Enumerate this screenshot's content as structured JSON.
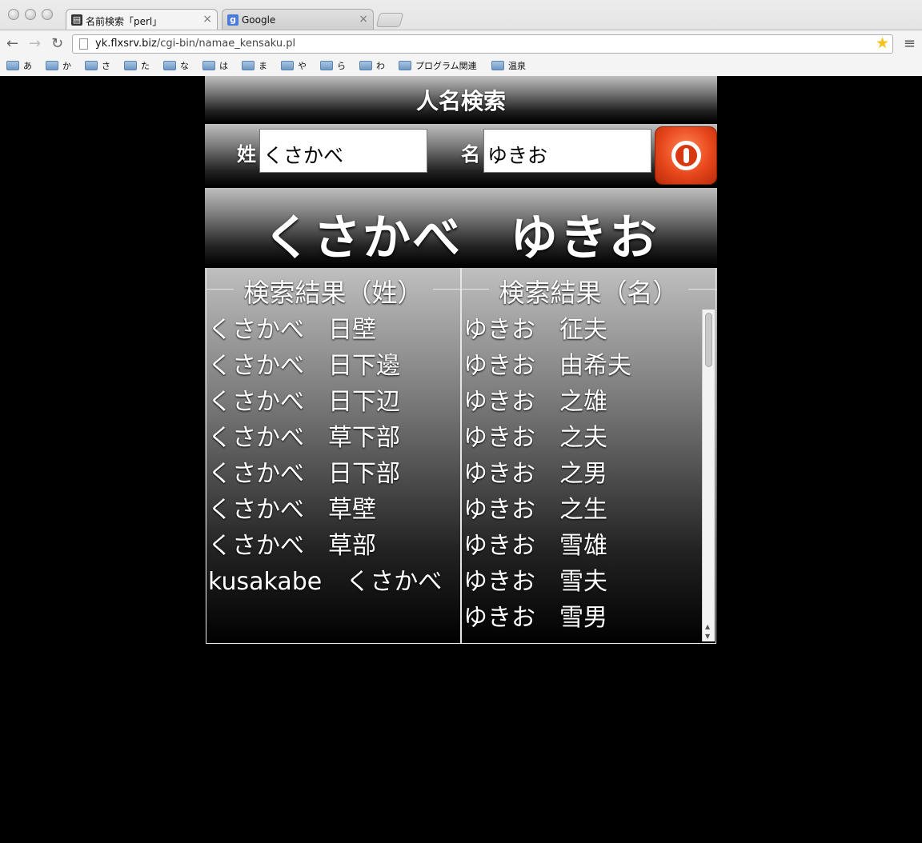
{
  "browser": {
    "tabs": [
      {
        "title": "名前検索「perl」",
        "favicon": "page-icon"
      },
      {
        "title": "Google",
        "favicon": "google-icon"
      }
    ],
    "url_host": "yk.flxsrv.biz",
    "url_path": "/cgi-bin/namae_kensaku.pl",
    "bookmarks": [
      "あ",
      "か",
      "さ",
      "た",
      "な",
      "は",
      "ま",
      "や",
      "ら",
      "わ",
      "プログラム関連",
      "温泉"
    ]
  },
  "page": {
    "title": "人名検索",
    "surname_label": "姓",
    "surname_value": "くさかべ",
    "given_label": "名",
    "given_value": "ゆきお",
    "result_surname": "くさかべ",
    "result_given": "ゆきお",
    "surname_panel_title": "検索結果（姓）",
    "given_panel_title": "検索結果（名）",
    "surname_results": [
      "くさかべ　日壁",
      "くさかべ　日下邊",
      "くさかべ　日下辺",
      "くさかべ　草下部",
      "くさかべ　日下部",
      "くさかべ　草壁",
      "くさかべ　草部",
      "kusakabe　くさかべ"
    ],
    "given_results": [
      "ゆきお　征夫",
      "ゆきお　由希夫",
      "ゆきお　之雄",
      "ゆきお　之夫",
      "ゆきお　之男",
      "ゆきお　之生",
      "ゆきお　雪雄",
      "ゆきお　雪夫",
      "ゆきお　雪男"
    ]
  },
  "colors": {
    "go_button": "#e8471c",
    "star": "#f4c218"
  }
}
